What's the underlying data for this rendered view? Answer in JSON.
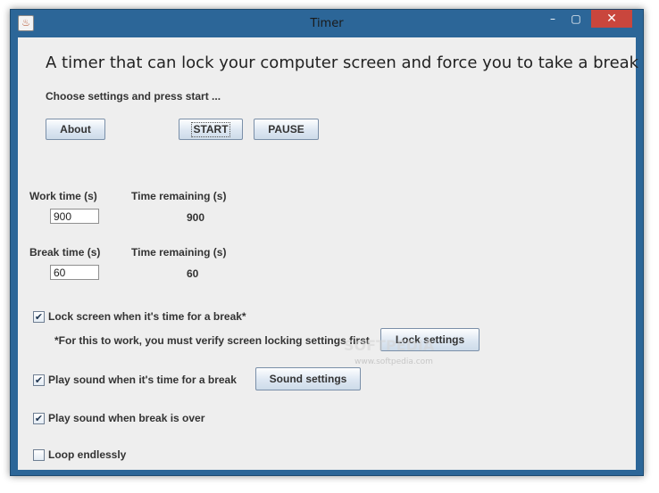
{
  "window": {
    "title": "Timer",
    "app_icon": "java-cup-icon",
    "controls": {
      "minimize": "–",
      "maximize": "▢",
      "close": "✕"
    }
  },
  "header": {
    "heading": "A timer that can lock your computer screen and force you to take a break",
    "instruction": "Choose settings and press start ..."
  },
  "buttons": {
    "about": "About",
    "start": "START",
    "pause": "PAUSE",
    "lock_settings": "Lock settings",
    "sound_settings": "Sound settings"
  },
  "work": {
    "label": "Work time (s)",
    "value": "900",
    "remaining_label": "Time remaining (s)",
    "remaining": "900"
  },
  "break": {
    "label": "Break time (s)",
    "value": "60",
    "remaining_label": "Time remaining (s)",
    "remaining": "60"
  },
  "options": {
    "lock_screen": {
      "label": "Lock screen when it's time for a break*",
      "checked": true
    },
    "lock_note": "*For this to work, you must verify screen locking settings first",
    "play_sound_break": {
      "label": "Play sound when it's time for a break",
      "checked": true
    },
    "play_sound_over": {
      "label": "Play sound when break is over",
      "checked": true
    },
    "loop": {
      "label": "Loop endlessly",
      "checked": false
    }
  },
  "watermark": {
    "logo": "SOFTPEDIA",
    "url": "www.softpedia.com"
  },
  "colors": {
    "frame": "#2c6698",
    "close_button": "#c9463d",
    "client_background": "#eeeeee"
  }
}
